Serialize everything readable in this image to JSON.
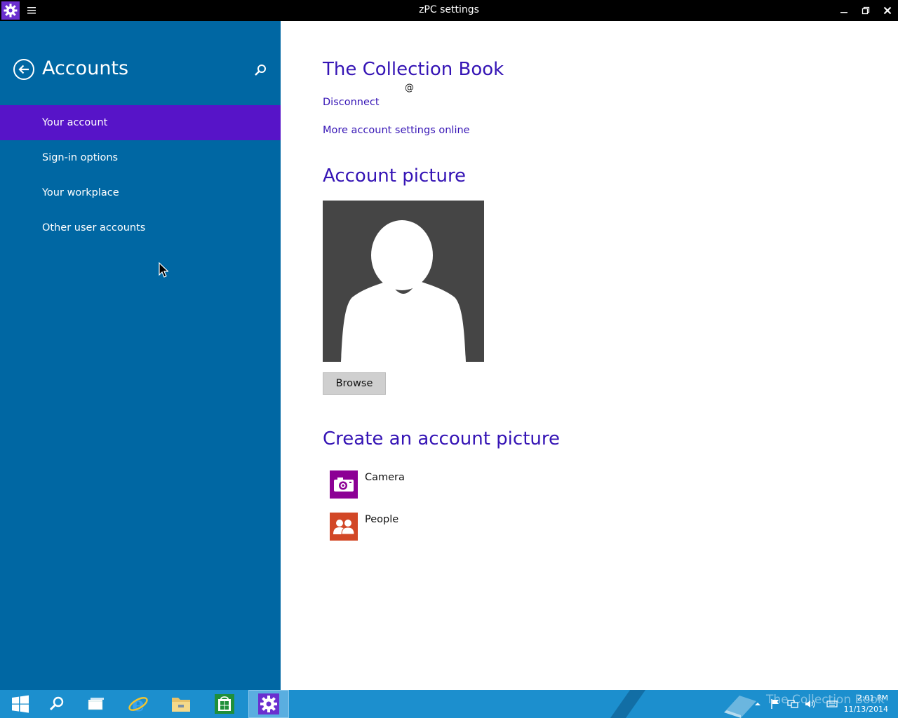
{
  "window": {
    "title": "zPC settings",
    "app_icon": "gear-icon",
    "menu_icon": "hamburger-icon",
    "controls": [
      "minimize-icon",
      "restore-icon",
      "close-icon"
    ]
  },
  "sidebar": {
    "title": "Accounts",
    "back_icon": "back-arrow-icon",
    "search_icon": "search-icon",
    "items": [
      {
        "label": "Your account",
        "active": true
      },
      {
        "label": "Sign-in options",
        "active": false
      },
      {
        "label": "Your workplace",
        "active": false
      },
      {
        "label": "Other user accounts",
        "active": false
      }
    ]
  },
  "account": {
    "name": "The Collection Book",
    "email": "@",
    "disconnect_label": "Disconnect",
    "more_settings_label": "More account settings online"
  },
  "picture": {
    "heading": "Account picture",
    "browse_label": "Browse"
  },
  "create": {
    "heading": "Create an account picture",
    "apps": [
      {
        "label": "Camera",
        "icon": "camera-icon",
        "color": "#8c0095"
      },
      {
        "label": "People",
        "icon": "people-icon",
        "color": "#d24726"
      }
    ]
  },
  "taskbar": {
    "buttons": [
      "windows-start-icon",
      "search-icon",
      "task-view-icon",
      "internet-explorer-icon",
      "file-explorer-icon",
      "store-icon",
      "settings-icon"
    ],
    "watermark": "The Collection Book",
    "time": "2:01 PM",
    "date": "11/13/2014"
  },
  "colors": {
    "sidebar": "#0067a3",
    "accent": "#5714c8",
    "link": "#3514b5",
    "taskbar": "#1c8fce"
  }
}
